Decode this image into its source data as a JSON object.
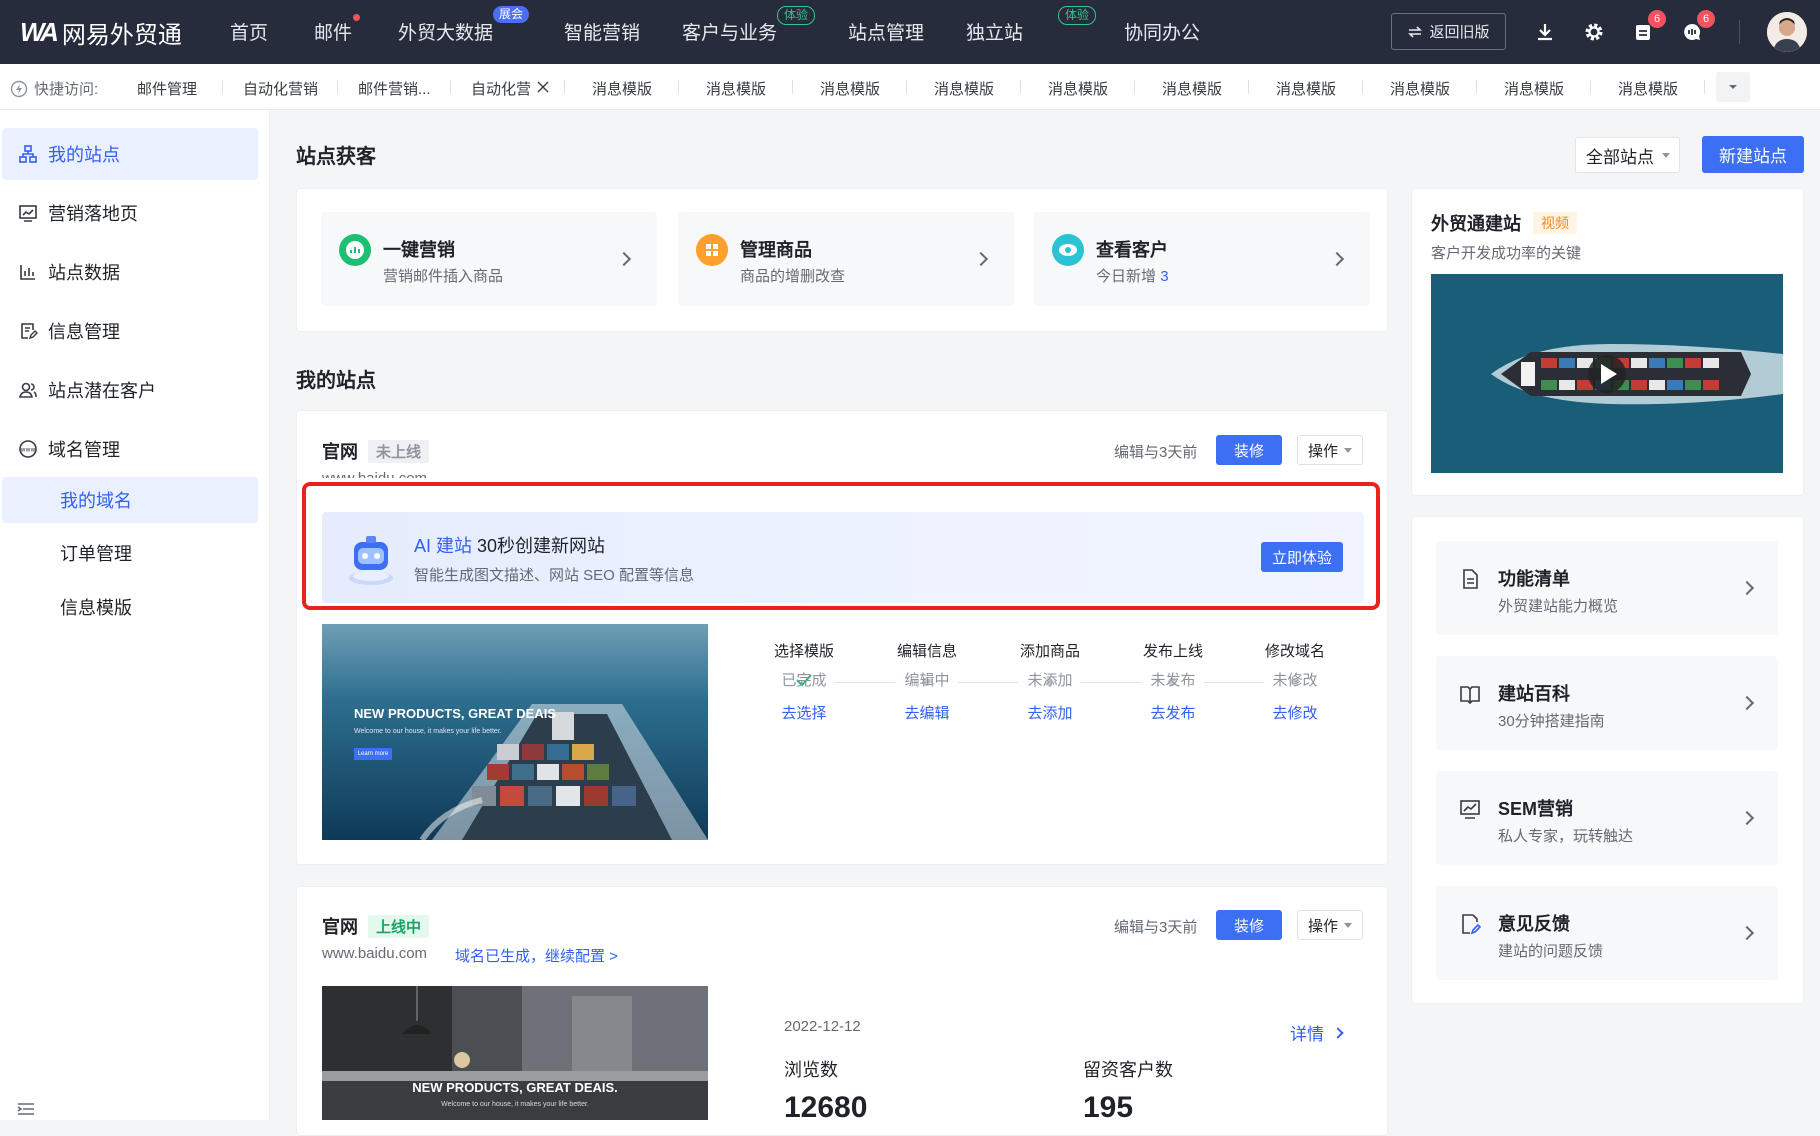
{
  "topbar": {
    "logo_mark": "WA",
    "logo_text": "网易外贸通",
    "nav": [
      {
        "label": "首页"
      },
      {
        "label": "邮件"
      },
      {
        "label": "外贸大数据",
        "badge": "展会"
      },
      {
        "label": "智能营销"
      },
      {
        "label": "客户与业务",
        "badge": "体验"
      },
      {
        "label": "站点管理"
      },
      {
        "label": "独立站",
        "badge": "体验"
      },
      {
        "label": "协同办公"
      }
    ],
    "back_label": "返回旧版",
    "calendar_count": "6",
    "message_count": "6"
  },
  "quickbar": {
    "label": "快捷访问:",
    "tabs": [
      "邮件管理",
      "自动化营销",
      "邮件营销...",
      "自动化营",
      "消息模版",
      "消息模版",
      "消息模版",
      "消息模版",
      "消息模版",
      "消息模版",
      "消息模版",
      "消息模版",
      "消息模版",
      "消息模版"
    ]
  },
  "sidebar": {
    "items": [
      {
        "label": "我的站点"
      },
      {
        "label": "营销落地页"
      },
      {
        "label": "站点数据"
      },
      {
        "label": "信息管理"
      },
      {
        "label": "站点潜在客户"
      },
      {
        "label": "域名管理"
      }
    ],
    "subitems": [
      {
        "label": "我的域名"
      },
      {
        "label": "订单管理"
      },
      {
        "label": "信息模版"
      }
    ]
  },
  "main": {
    "acquire_title": "站点获客",
    "all_sites": "全部站点",
    "new_site": "新建站点",
    "features": [
      {
        "title": "一键营销",
        "sub": "营销邮件插入商品",
        "color": "#1dbf73"
      },
      {
        "title": "管理商品",
        "sub": "商品的增删改查",
        "color": "#ff9f2e"
      },
      {
        "title": "查看客户",
        "sub": "今日新增",
        "count": "3",
        "color": "#29c3d4"
      }
    ],
    "mysites_title": "我的站点",
    "site1": {
      "name": "官网",
      "status": "未上线",
      "domain": "www.baidu.com",
      "edit_time": "编辑与3天前",
      "decorate": "装修",
      "operate": "操作",
      "ai": {
        "prefix": "AI 建站",
        "title": "30秒创建新网站",
        "desc": "智能生成图文描述、网站 SEO 配置等信息",
        "button": "立即体验"
      },
      "thumb_title": "NEW PRODUCTS, GREAT DEAIS",
      "thumb_sub": "Welcome to our house, it makes your life better.",
      "thumb_btn": "Learn more",
      "steps": [
        {
          "name": "选择模版",
          "state": "已完成",
          "action": "去选择"
        },
        {
          "name": "编辑信息",
          "state": "编辑中",
          "action": "去编辑"
        },
        {
          "name": "添加商品",
          "state": "未添加",
          "action": "去添加"
        },
        {
          "name": "发布上线",
          "state": "未发布",
          "action": "去发布"
        },
        {
          "name": "修改域名",
          "state": "未修改",
          "action": "去修改"
        }
      ]
    },
    "site2": {
      "name": "官网",
      "status": "上线中",
      "domain": "www.baidu.com",
      "domain_note": "域名已生成，继续配置 >",
      "edit_time": "编辑与3天前",
      "decorate": "装修",
      "operate": "操作",
      "thumb_title": "NEW PRODUCTS, GREAT DEAIS.",
      "thumb_sub": "Welcome to our house, it makes your life better.",
      "date": "2022-12-12",
      "detail": "详情",
      "views_label": "浏览数",
      "views": "12680",
      "leads_label": "留资客户数",
      "leads": "195"
    }
  },
  "right": {
    "video_title": "外贸通建站",
    "video_tag": "视频",
    "video_sub": "客户开发成功率的关键",
    "cards": [
      {
        "title": "功能清单",
        "sub": "外贸建站能力概览"
      },
      {
        "title": "建站百科",
        "sub": "30分钟搭建指南"
      },
      {
        "title": "SEM营销",
        "sub": "私人专家，玩转触达"
      },
      {
        "title": "意见反馈",
        "sub": "建站的问题反馈"
      }
    ]
  }
}
